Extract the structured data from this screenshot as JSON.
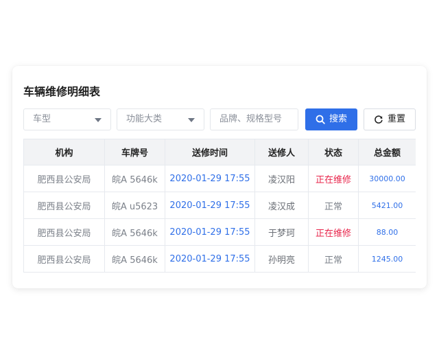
{
  "title": "车辆维修明细表",
  "filters": {
    "vehicle_type": "车型",
    "function_category": "功能大类",
    "brand_placeholder": "品牌、规格型号"
  },
  "buttons": {
    "search": "搜索",
    "reset": "重置"
  },
  "table": {
    "columns": [
      "机构",
      "车牌号",
      "送修时间",
      "送修人",
      "状态",
      "总金额"
    ],
    "rows": [
      {
        "org": "肥西县公安局",
        "plate": "皖A 5646k",
        "time": "2020-01-29 17:55",
        "person": "凌汉阳",
        "status": "正在维修",
        "amount": "30000.00"
      },
      {
        "org": "肥西县公安局",
        "plate": "皖A u5623",
        "time": "2020-01-29 17:55",
        "person": "凌汉成",
        "status": "正常",
        "amount": "5421.00"
      },
      {
        "org": "肥西县公安局",
        "plate": "皖A 5646k",
        "time": "2020-01-29 17:55",
        "person": "于梦珂",
        "status": "正在维修",
        "amount": "88.00"
      },
      {
        "org": "肥西县公安局",
        "plate": "皖A 5646k",
        "time": "2020-01-29 17:55",
        "person": "孙明亮",
        "status": "正常",
        "amount": "1245.00"
      }
    ]
  },
  "colors": {
    "primary": "#2f6fe8",
    "status_repair": "#e8244a",
    "header_bg": "#f2f3f5"
  },
  "icons": {
    "search": "search-icon",
    "reset": "refresh-icon",
    "dropdown": "caret-down-icon"
  }
}
